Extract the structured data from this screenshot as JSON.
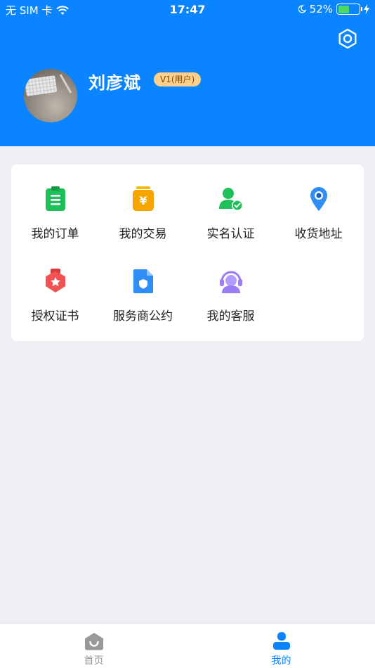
{
  "status_bar": {
    "carrier": "无 SIM 卡",
    "time": "17:47",
    "battery": "52%",
    "battery_level": 0.52
  },
  "profile": {
    "name": "刘彦斌",
    "level_badge": "V1(用户)"
  },
  "menu": [
    {
      "label": "我的订单",
      "icon": "order-clipboard-icon",
      "color": "#1fbf5a"
    },
    {
      "label": "我的交易",
      "icon": "yuan-wallet-icon",
      "color": "#f6a400"
    },
    {
      "label": "实名认证",
      "icon": "verified-user-icon",
      "color": "#1fbf5a"
    },
    {
      "label": "收货地址",
      "icon": "location-pin-icon",
      "color": "#2f8ef5"
    },
    {
      "label": "授权证书",
      "icon": "certificate-badge-icon",
      "color": "#f25252"
    },
    {
      "label": "服务商公约",
      "icon": "shield-document-icon",
      "color": "#2f8ef5"
    },
    {
      "label": "我的客服",
      "icon": "headset-support-icon",
      "color": "#9a7cf5"
    }
  ],
  "tabs": [
    {
      "label": "首页",
      "icon": "home-icon",
      "active": false
    },
    {
      "label": "我的",
      "icon": "profile-icon",
      "active": true
    }
  ],
  "colors": {
    "header": "#0a85ff",
    "active_tab": "#0a85ff",
    "inactive_tab": "#999999"
  }
}
